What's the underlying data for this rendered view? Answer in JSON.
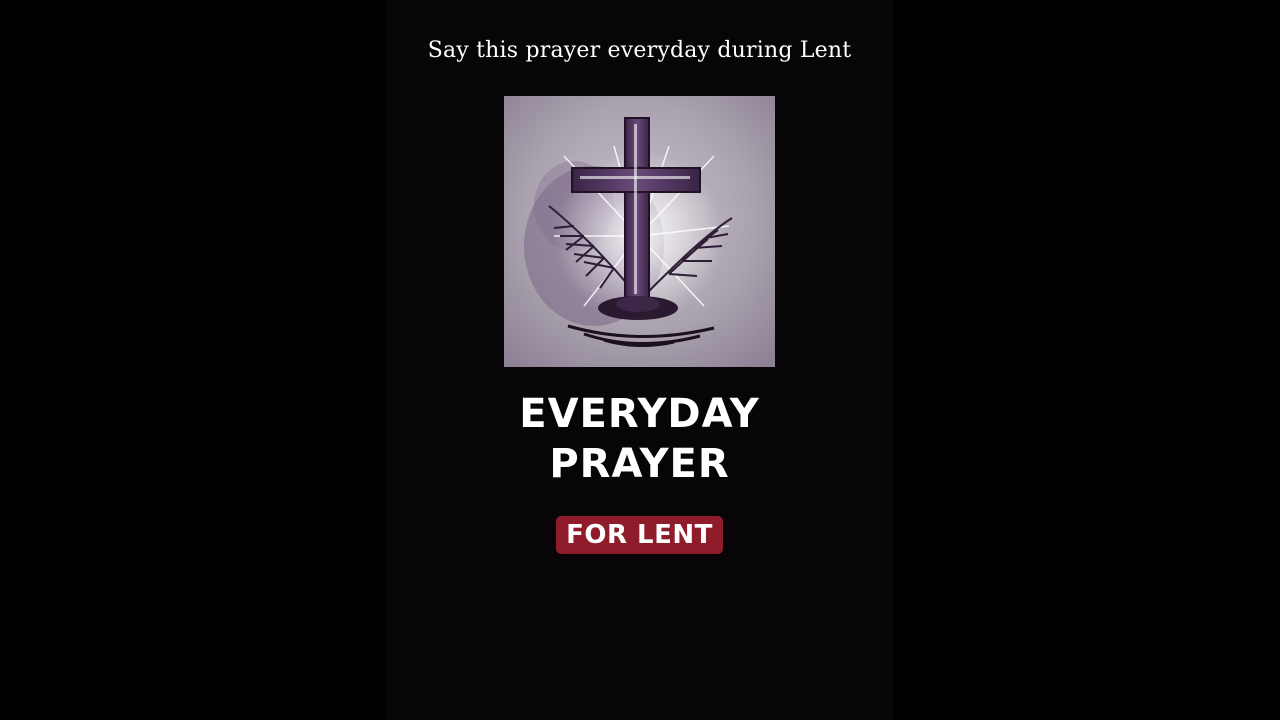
{
  "caption": "Say this prayer everyday during Lent",
  "artwork": {
    "icon": "cross-with-palm-icon",
    "colors": {
      "background": "#a69fac",
      "cross": "#4a2f57",
      "accent": "#ffffff"
    }
  },
  "title": {
    "line1": "EVERYDAY",
    "line2": "PRAYER"
  },
  "badge": {
    "label": "FOR LENT",
    "color": "#8e1c2b"
  },
  "colors": {
    "background": "#000000",
    "panel": "#070505",
    "text": "#ffffff"
  }
}
